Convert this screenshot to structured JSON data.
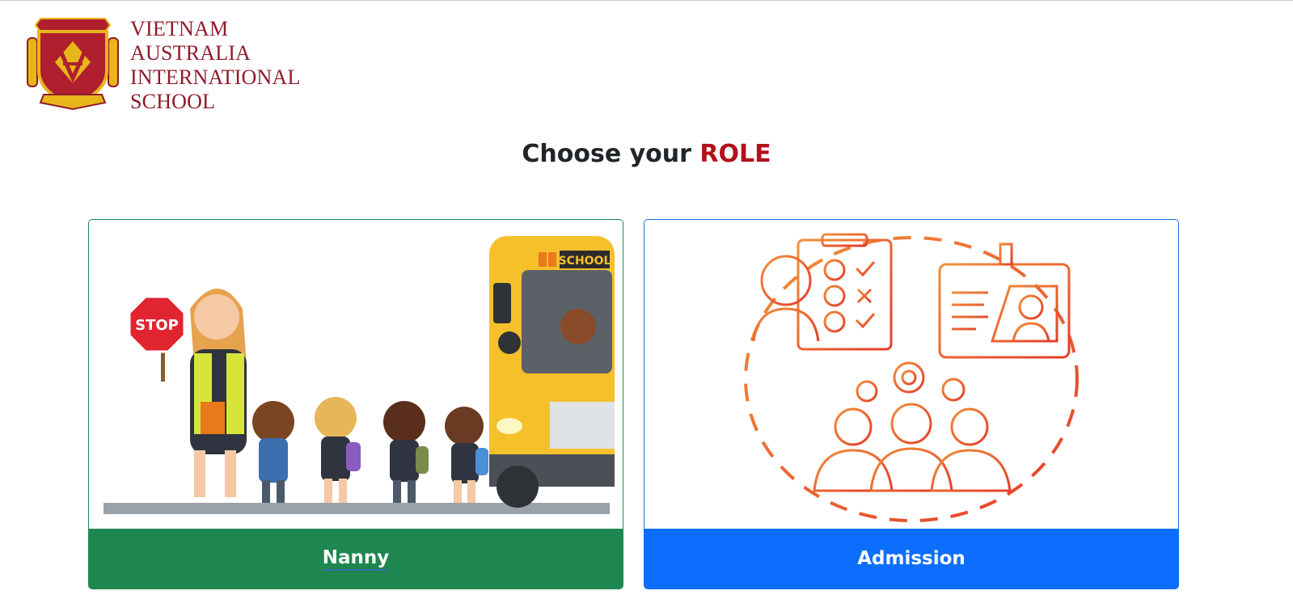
{
  "logo": {
    "lines": [
      "VIETNAM",
      "AUSTRALIA",
      "INTERNATIONAL",
      "SCHOOL"
    ],
    "crest_icon": "school-crest-icon",
    "colors": {
      "maroon": "#8e1b2a",
      "gold": "#e8b51a"
    }
  },
  "heading": {
    "prefix": "Choose your",
    "accent": "ROLE",
    "accent_color": "#b3101c"
  },
  "roles": [
    {
      "label": "Nanny",
      "illustration": "crossing-guard-with-children-and-school-bus",
      "color": "#1e8750",
      "bus_sign": "SCHOOL",
      "stop_sign": "STOP"
    },
    {
      "label": "Admission",
      "illustration": "admission-process-icon",
      "color": "#0d6efd"
    }
  ]
}
